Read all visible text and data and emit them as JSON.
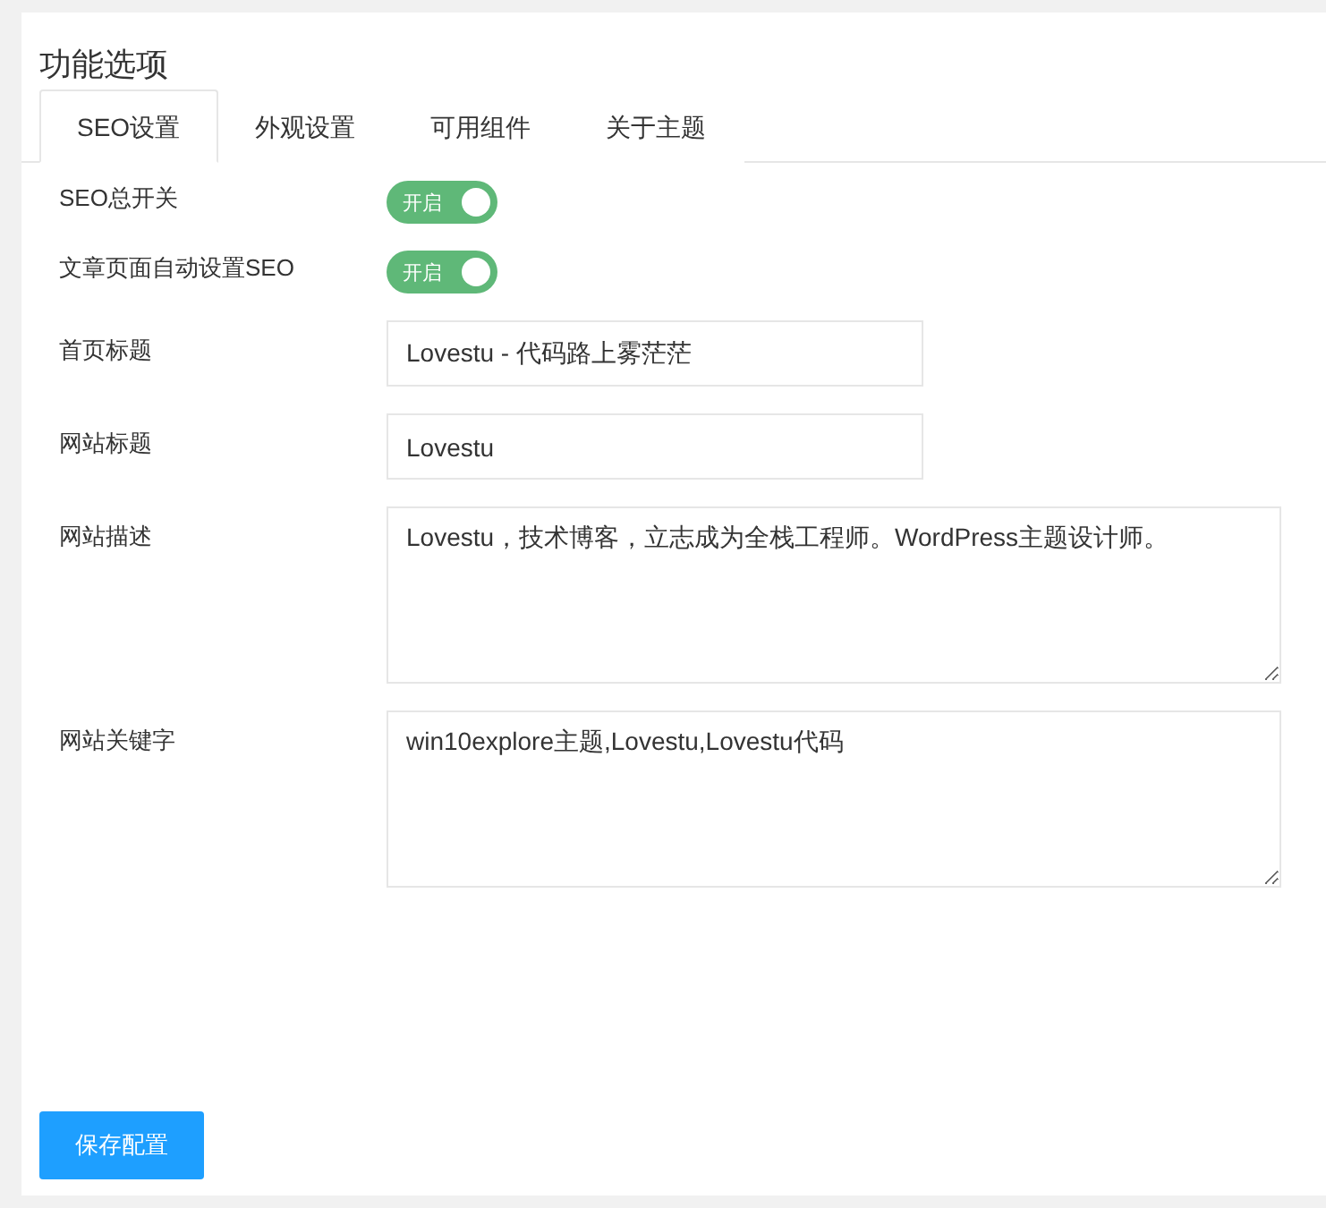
{
  "title": "功能选项",
  "tabs": [
    {
      "label": "SEO设置",
      "selected": true
    },
    {
      "label": "外观设置",
      "selected": false
    },
    {
      "label": "可用组件",
      "selected": false
    },
    {
      "label": "关于主题",
      "selected": false
    }
  ],
  "fields": [
    {
      "kind": "switch",
      "label": "SEO总开关",
      "on": true,
      "switch_text": "开启"
    },
    {
      "kind": "switch",
      "label": "文章页面自动设置SEO",
      "on": true,
      "switch_text": "开启"
    },
    {
      "kind": "input",
      "label": "首页标题",
      "value": "Lovestu - 代码路上雾茫茫"
    },
    {
      "kind": "input",
      "label": "网站标题",
      "value": "Lovestu"
    },
    {
      "kind": "textarea",
      "label": "网站描述",
      "value": "Lovestu，技术博客，立志成为全栈工程师。WordPress主题设计师。"
    },
    {
      "kind": "textarea",
      "label": "网站关键字",
      "value": "win10explore主题,Lovestu,Lovestu代码"
    }
  ],
  "save_button": "保存配置"
}
